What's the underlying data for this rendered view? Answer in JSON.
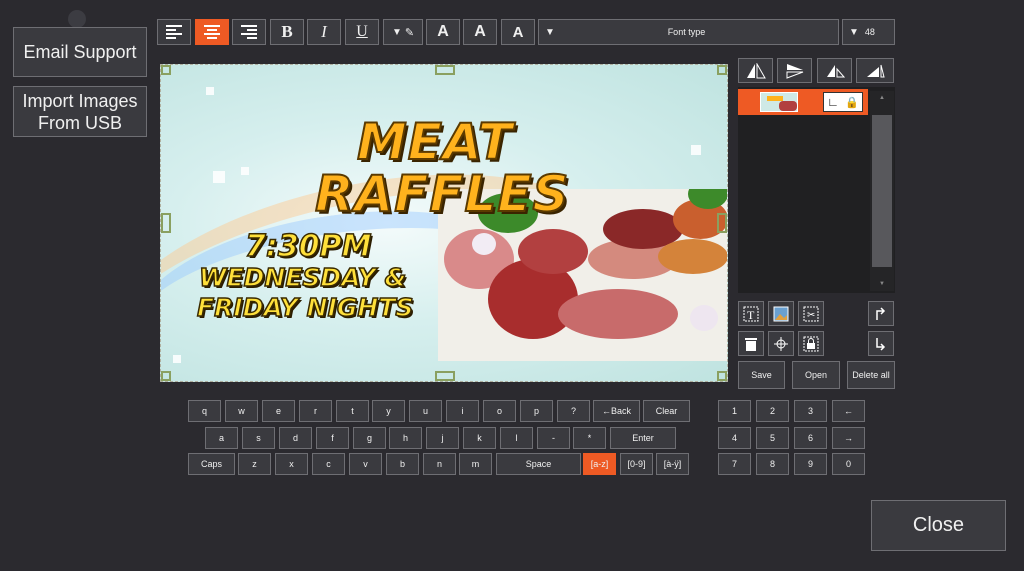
{
  "sidebar": {
    "email_support": "Email Support",
    "import_line1": "Import Images",
    "import_line2": "From USB"
  },
  "toolbar": {
    "align_left": "align-left-icon",
    "align_center": "align-center-icon",
    "align_right": "align-right-icon",
    "bold": "B",
    "italic": "I",
    "underline": "U",
    "text_style_1": "A",
    "text_style_2": "A",
    "text_style_3": "A",
    "font_type": "Font type",
    "font_size": "48"
  },
  "canvas": {
    "title_line1": "MEAT",
    "title_line2": "RAFFLES",
    "time": "7:30PM",
    "day_line1": "WEDNESDAY &",
    "day_line2": "FRIDAY NIGHTS"
  },
  "actions": {
    "save": "Save",
    "open": "Open",
    "delete_all": "Delete all"
  },
  "keyboard": {
    "row1": [
      "q",
      "w",
      "e",
      "r",
      "t",
      "y",
      "u",
      "i",
      "o",
      "p",
      "?",
      "←Back",
      "Clear"
    ],
    "row2": [
      "a",
      "s",
      "d",
      "f",
      "g",
      "h",
      "j",
      "k",
      "l",
      "-",
      "*",
      "Enter"
    ],
    "row3": [
      "Caps",
      "z",
      "x",
      "c",
      "v",
      "b",
      "n",
      "m",
      "Space",
      "[a-z]",
      "[0-9]",
      "[à-ÿ]"
    ],
    "numpad": [
      "1",
      "2",
      "3",
      "←",
      "4",
      "5",
      "6",
      "→",
      "7",
      "8",
      "9",
      "0"
    ]
  },
  "close": "Close",
  "colors": {
    "accent": "#ee5a24",
    "background": "#2b2a2f"
  }
}
